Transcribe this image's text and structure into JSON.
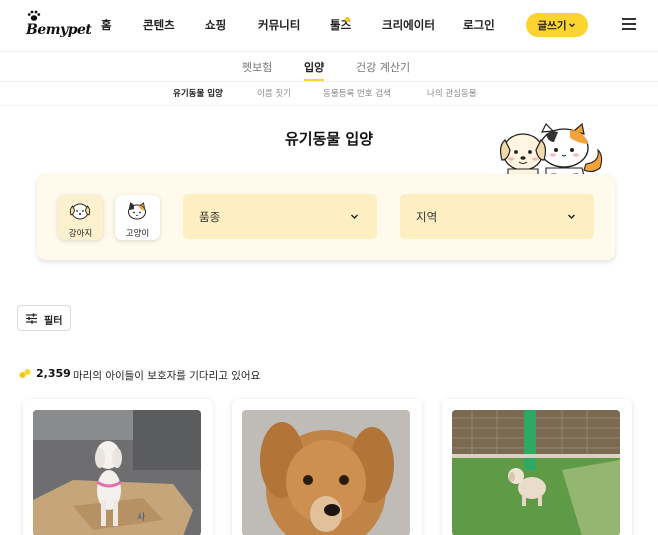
{
  "brand": {
    "logo_text": "Bemypet"
  },
  "nav": {
    "items": [
      "홈",
      "콘텐츠",
      "쇼핑",
      "커뮤니티",
      "툴즈",
      "크리에이터",
      "로그인"
    ],
    "write_button": "글쓰기",
    "accent": "#fcd42f"
  },
  "tabs": {
    "items": [
      "펫보험",
      "입양",
      "건강 계산기"
    ],
    "active": "입양"
  },
  "subtabs": {
    "items": [
      "유기동물 입양",
      "이름 짓기",
      "동물등록 번호 검색",
      "나의 관심동물"
    ],
    "active": "유기동물 입양"
  },
  "page": {
    "title": "유기동물 입양"
  },
  "search": {
    "animals": [
      {
        "label": "강아지",
        "icon": "dog-face-icon",
        "selected": true
      },
      {
        "label": "고양이",
        "icon": "cat-face-icon",
        "selected": false
      }
    ],
    "breed_select": "품종",
    "region_select": "지역"
  },
  "filter": {
    "label": "필터"
  },
  "results": {
    "count": "2,359",
    "message": "마리의 아이들이 보호자를 기다리고 있어요"
  },
  "cards": [
    {
      "image": "white-dog-photo"
    },
    {
      "image": "brown-dog-photo"
    },
    {
      "image": "small-white-dog-on-grass-photo"
    }
  ]
}
